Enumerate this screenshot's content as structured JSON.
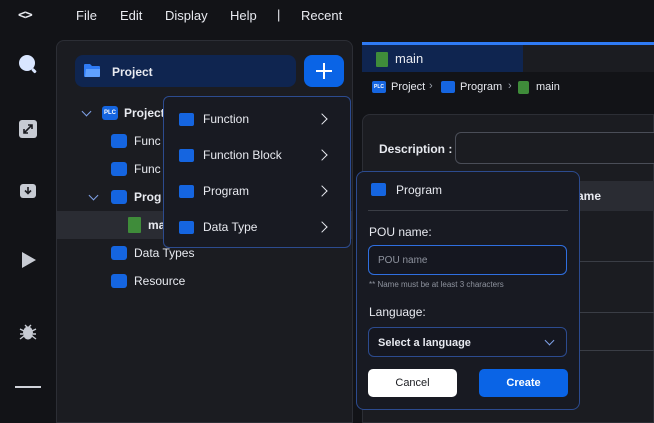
{
  "app": {
    "logo_text": "<>"
  },
  "menu": {
    "items": [
      "File",
      "Edit",
      "Display",
      "Help"
    ],
    "separator": "|",
    "recent": "Recent"
  },
  "rail": {
    "icons": [
      "search-icon",
      "expand-icon",
      "download-icon",
      "play-icon",
      "bug-icon"
    ]
  },
  "explorer": {
    "project_button": "Project",
    "add_button_icon": "plus-icon",
    "tree": [
      {
        "label": "Project",
        "icon": "plc-icon"
      },
      {
        "label": "Func",
        "icon": "function-icon"
      },
      {
        "label": "Func",
        "icon": "function-block-icon"
      },
      {
        "label": "Prog",
        "icon": "program-icon"
      },
      {
        "label": "ma",
        "icon": "file-icon"
      },
      {
        "label": "Data Types",
        "icon": "data-type-icon"
      },
      {
        "label": "Resource",
        "icon": "resource-icon"
      }
    ]
  },
  "add_menu": {
    "items": [
      {
        "label": "Function",
        "icon": "function-icon"
      },
      {
        "label": "Function Block",
        "icon": "function-block-icon"
      },
      {
        "label": "Program",
        "icon": "program-icon"
      },
      {
        "label": "Data Type",
        "icon": "data-type-icon"
      }
    ]
  },
  "editor": {
    "tab_label": "main",
    "breadcrumb": [
      "Project",
      "Program",
      "main"
    ],
    "plc_badge": "PLC",
    "description_label": "Description :",
    "table_header_partial": "ame"
  },
  "pou_dialog": {
    "title": "Program",
    "name_label": "POU name:",
    "name_placeholder": "POU name",
    "name_hint": "** Name must be at least 3 characters",
    "language_label": "Language:",
    "language_value": "Select a language",
    "cancel": "Cancel",
    "create": "Create"
  },
  "colors": {
    "accent": "#0a64e6",
    "background": "#121317",
    "panel": "#1b1c21",
    "selected": "#0f2550"
  }
}
